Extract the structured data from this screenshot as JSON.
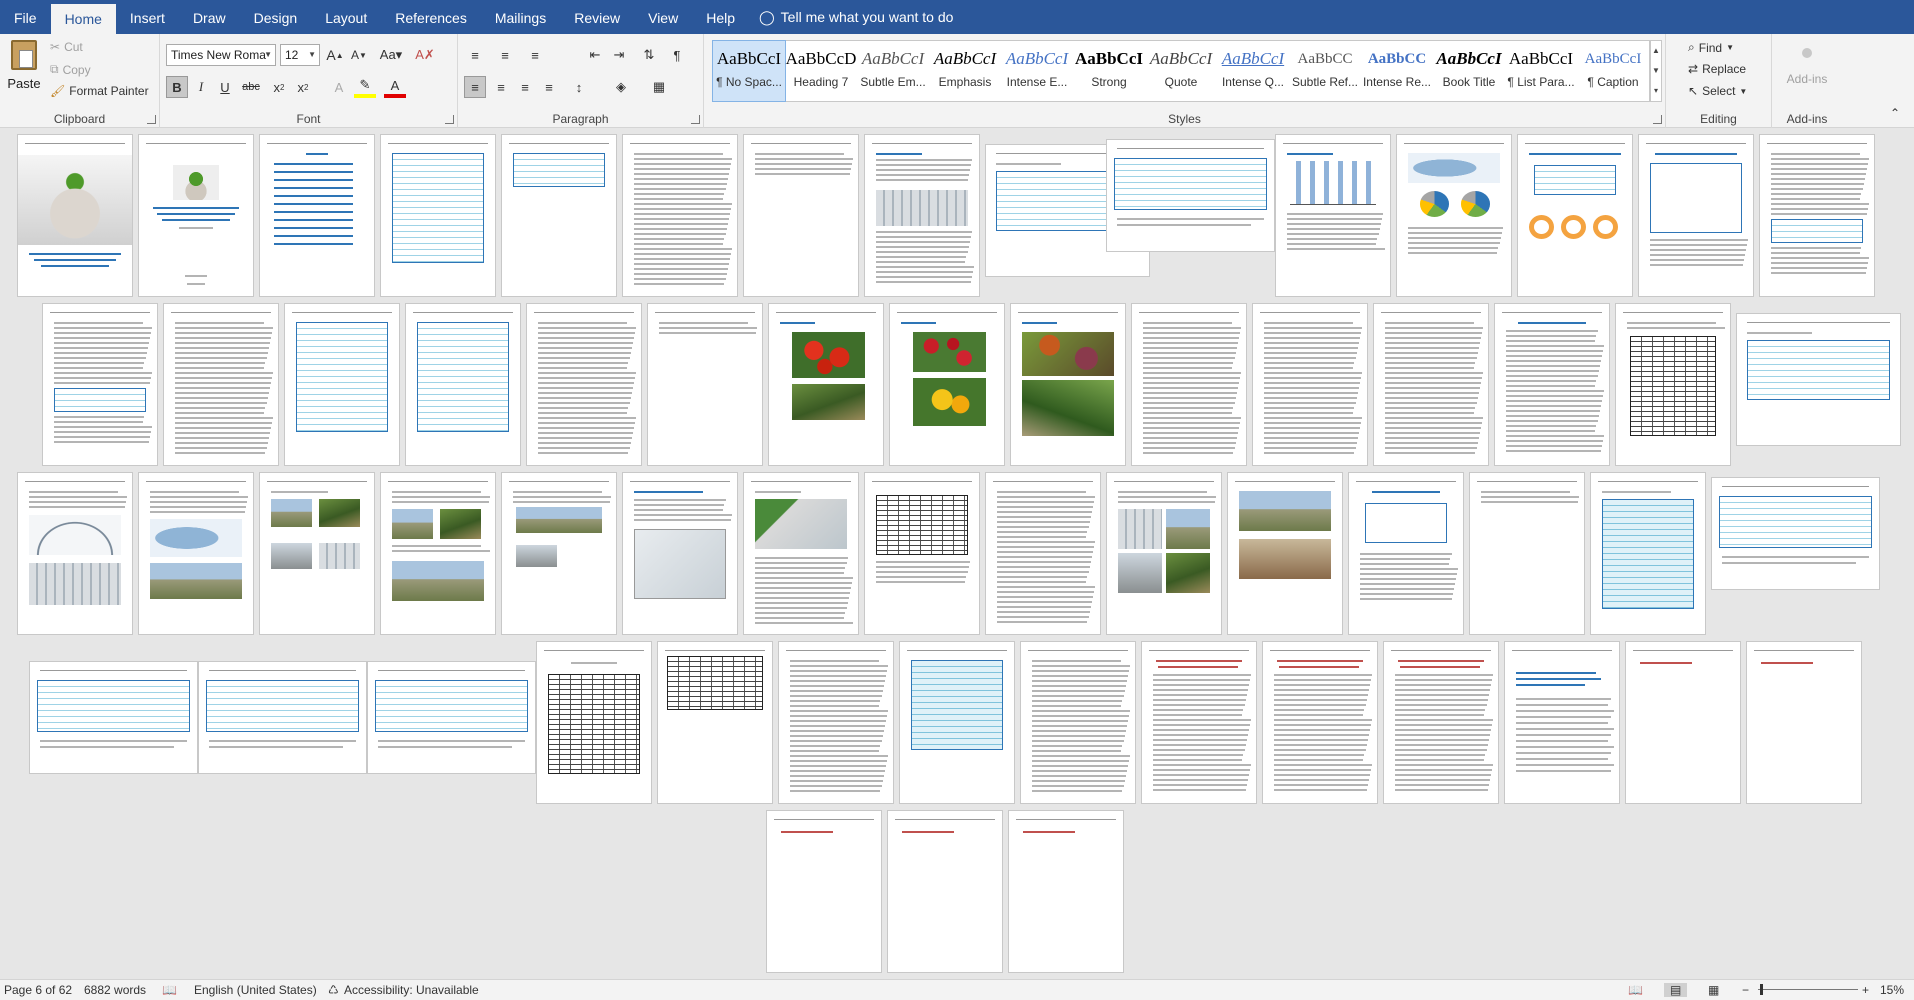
{
  "tabs": [
    "File",
    "Home",
    "Insert",
    "Draw",
    "Design",
    "Layout",
    "References",
    "Mailings",
    "Review",
    "View",
    "Help"
  ],
  "active_tab": "Home",
  "tell_me": "Tell me what you want to do",
  "clipboard": {
    "label": "Clipboard",
    "paste": "Paste",
    "cut": "Cut",
    "copy": "Copy",
    "format_painter": "Format Painter"
  },
  "font": {
    "label": "Font",
    "family": "Times New Roma",
    "size": "12"
  },
  "paragraph": {
    "label": "Paragraph"
  },
  "styles": {
    "label": "Styles",
    "items": [
      {
        "preview": "AaBbCcI",
        "name": "¶ No Spac..."
      },
      {
        "preview": "AaBbCcD",
        "name": "Heading 7"
      },
      {
        "preview": "AaBbCcI",
        "name": "Subtle Em..."
      },
      {
        "preview": "AaBbCcI",
        "name": "Emphasis"
      },
      {
        "preview": "AaBbCcI",
        "name": "Intense E..."
      },
      {
        "preview": "AaBbCcI",
        "name": "Strong"
      },
      {
        "preview": "AaBbCcI",
        "name": "Quote"
      },
      {
        "preview": "AaBbCcI",
        "name": "Intense Q..."
      },
      {
        "preview": "AaBbCC",
        "name": "Subtle Ref..."
      },
      {
        "preview": "AaBbCC",
        "name": "Intense Re..."
      },
      {
        "preview": "AaBbCcI",
        "name": "Book Title"
      },
      {
        "preview": "AaBbCcI",
        "name": "¶ List Para..."
      },
      {
        "preview": "AaBbCcI",
        "name": "¶ Caption"
      }
    ]
  },
  "editing": {
    "label": "Editing",
    "find": "Find",
    "replace": "Replace",
    "select": "Select"
  },
  "addins": {
    "label": "Add-ins",
    "button": "Add-ins"
  },
  "status": {
    "page": "Page 6 of 62",
    "words": "6882 words",
    "language": "English (United States)",
    "accessibility": "Accessibility: Unavailable",
    "zoom": "15%"
  },
  "colors": {
    "accent": "#2b579a",
    "ribbon": "#f3f3f3",
    "canvas": "#e6e6e6"
  }
}
